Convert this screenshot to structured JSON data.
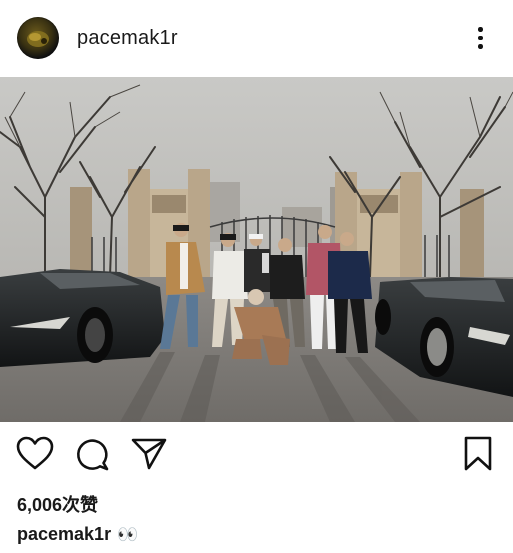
{
  "post": {
    "username": "pacemak1r",
    "likes_text": "6,006次赞",
    "caption_username": "pacemak1r",
    "caption_text": "👀"
  },
  "icons": {
    "avatar": "profile-avatar",
    "more": "more-vertical-icon",
    "like": "heart-icon",
    "comment": "comment-bubble-icon",
    "share": "paper-plane-icon",
    "save": "bookmark-icon"
  },
  "colors": {
    "text": "#1a1a1a",
    "background": "#ffffff",
    "icon": "#111111"
  }
}
